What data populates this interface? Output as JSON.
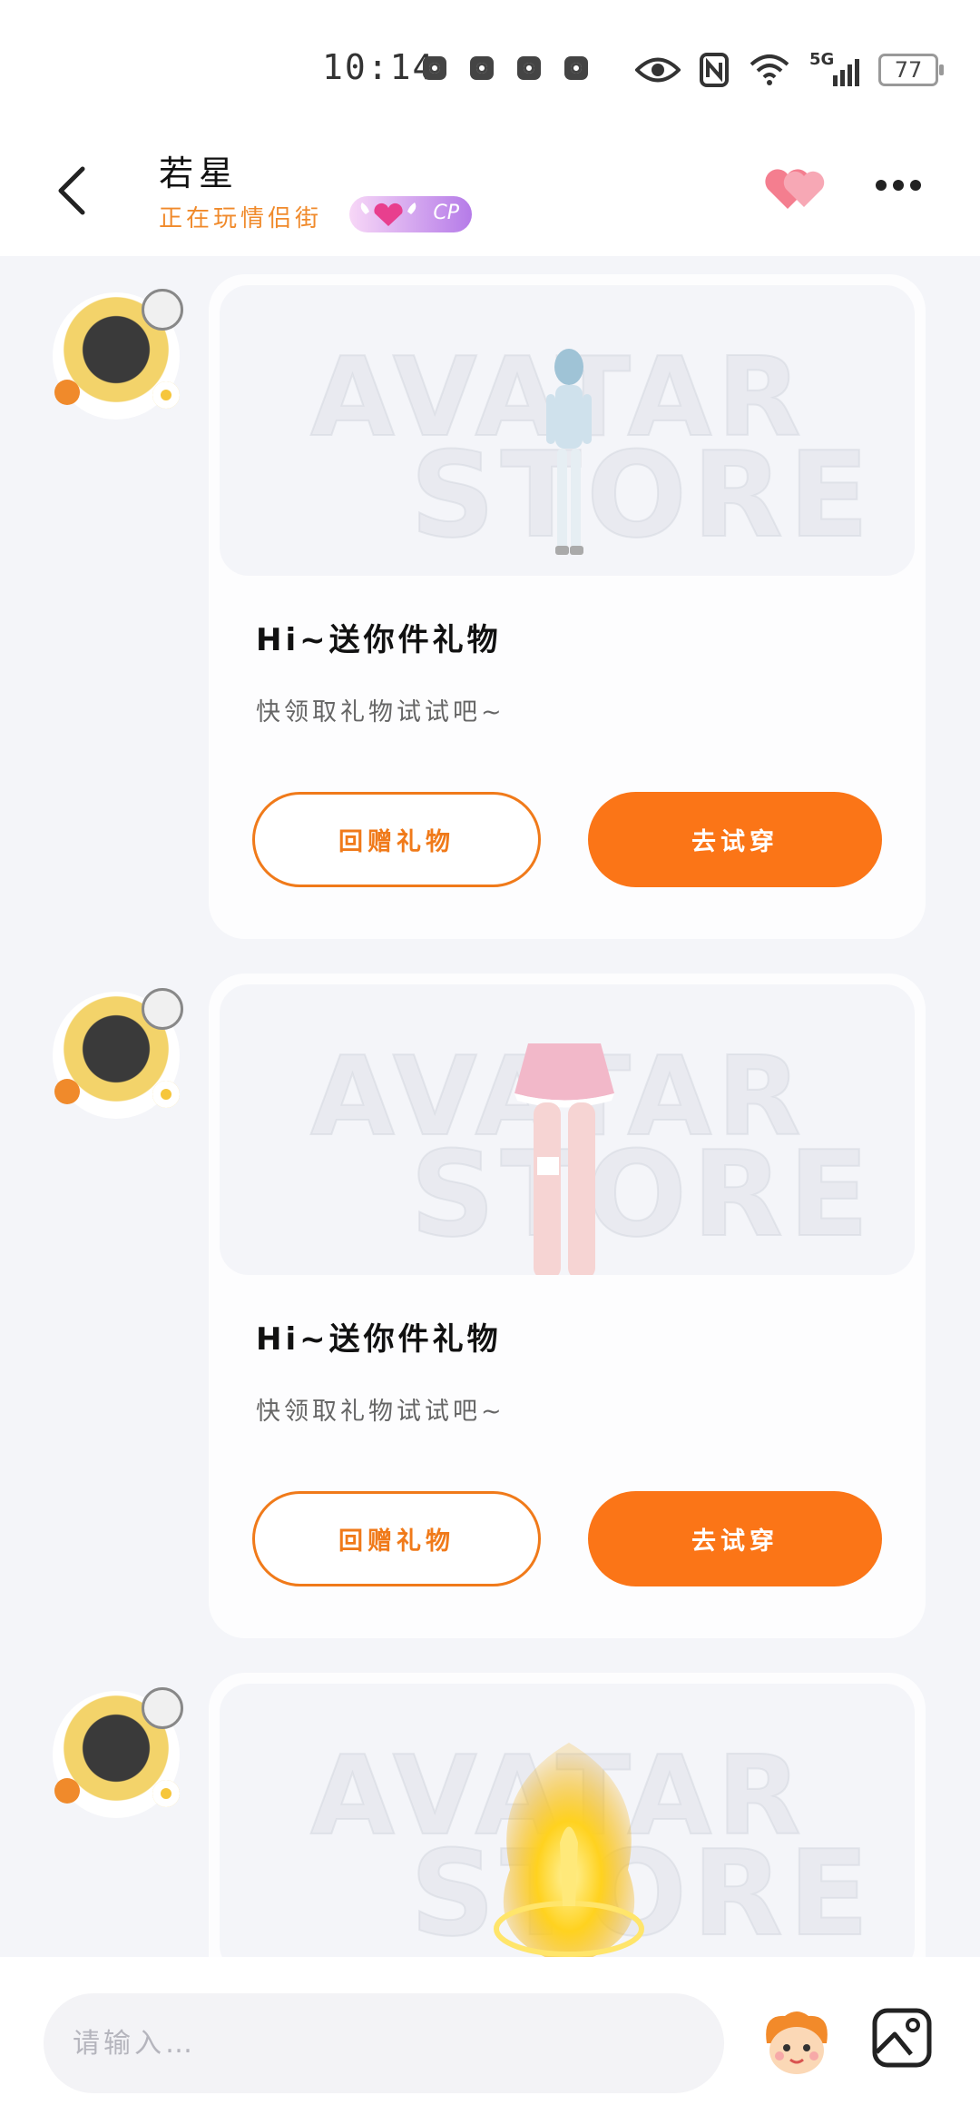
{
  "status_bar": {
    "time": "10:14",
    "network": "5G",
    "battery": "77"
  },
  "header": {
    "contact_name": "若星",
    "status_text": "正在玩情侣街",
    "badge_text": "CP"
  },
  "messages": [
    {
      "watermark_line1": "AVATAR",
      "watermark_line2": "STORE",
      "title": "Hi~送你件礼物",
      "subtitle": "快领取礼物试试吧~",
      "return_label": "回赠礼物",
      "try_label": "去试穿"
    },
    {
      "watermark_line1": "AVATAR",
      "watermark_line2": "STORE",
      "title": "Hi~送你件礼物",
      "subtitle": "快领取礼物试试吧~",
      "return_label": "回赠礼物",
      "try_label": "去试穿"
    },
    {
      "watermark_line1": "AVATAR",
      "watermark_line2": "STORE"
    }
  ],
  "input": {
    "placeholder": "请输入…"
  },
  "colors": {
    "accent": "#fb7517",
    "status_text": "#f08a2b",
    "background": "#f4f5f9"
  }
}
